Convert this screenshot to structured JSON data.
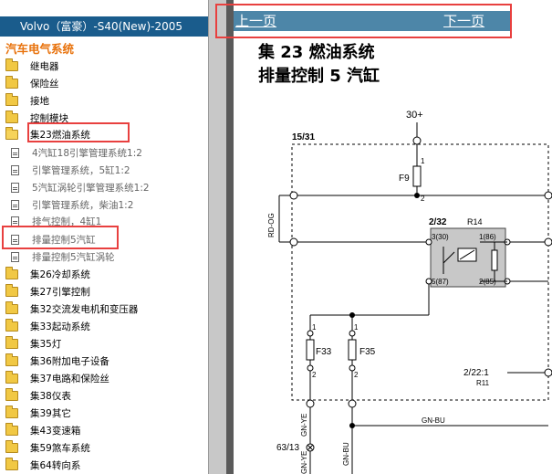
{
  "nav": {
    "header": "Volvo（富豪）-S40(New)-2005",
    "section": "汽车电气系统",
    "items": [
      {
        "label": "继电器",
        "type": "folder"
      },
      {
        "label": "保险丝",
        "type": "folder"
      },
      {
        "label": "接地",
        "type": "folder"
      },
      {
        "label": "控制模块",
        "type": "folder"
      },
      {
        "label": "集23燃油系统",
        "type": "folder-open"
      },
      {
        "label": "4汽缸18引擎管理系统1:2",
        "type": "doc"
      },
      {
        "label": "引擎管理系统，5缸1:2",
        "type": "doc"
      },
      {
        "label": "5汽缸涡轮引擎管理系统1:2",
        "type": "doc"
      },
      {
        "label": "引擎管理系统，柴油1:2",
        "type": "doc"
      },
      {
        "label": "排气控制，4缸1",
        "type": "doc"
      },
      {
        "label": "排量控制5汽缸",
        "type": "doc"
      },
      {
        "label": "排量控制5汽缸涡轮",
        "type": "doc"
      },
      {
        "label": "集26冷却系统",
        "type": "folder"
      },
      {
        "label": "集27引擎控制",
        "type": "folder"
      },
      {
        "label": "集32交流发电机和变压器",
        "type": "folder"
      },
      {
        "label": "集33起动系统",
        "type": "folder"
      },
      {
        "label": "集35灯",
        "type": "folder"
      },
      {
        "label": "集36附加电子设备",
        "type": "folder"
      },
      {
        "label": "集37电路和保险丝",
        "type": "folder"
      },
      {
        "label": "集38仪表",
        "type": "folder"
      },
      {
        "label": "集39其它",
        "type": "folder"
      },
      {
        "label": "集43变速箱",
        "type": "folder"
      },
      {
        "label": "集59煞车系统",
        "type": "folder"
      },
      {
        "label": "集64转向系",
        "type": "folder"
      }
    ]
  },
  "pager": {
    "prev": "上一页",
    "next": "下一页"
  },
  "content": {
    "title_line1": "集 23 燃油系统",
    "title_line2": "排量控制 5 汽缸"
  },
  "diagram": {
    "power": "30+",
    "module": "15/31",
    "fuse_f9": "F9",
    "pin_1": "1",
    "pin_2": "2",
    "wire_rd_og": "RD-OG",
    "relay_id": "2/32",
    "relay_name": "R14",
    "relay_p330": "3(30)",
    "relay_p186": "1(86)",
    "relay_p587": "5(87)",
    "relay_p285": "2(85)",
    "fuse_f33": "F33",
    "fuse_f35": "F35",
    "connector": "2/22:1",
    "connector_ref": "R11",
    "wire_gn_bu": "GN-BU",
    "wire_gn_ye": "GN-YE",
    "ground": "63/13"
  },
  "colors": {
    "header_bg": "#1a5c8c",
    "section_text": "#e8720c",
    "highlight": "#e8403f",
    "pager_bg": "#4d86a8"
  }
}
